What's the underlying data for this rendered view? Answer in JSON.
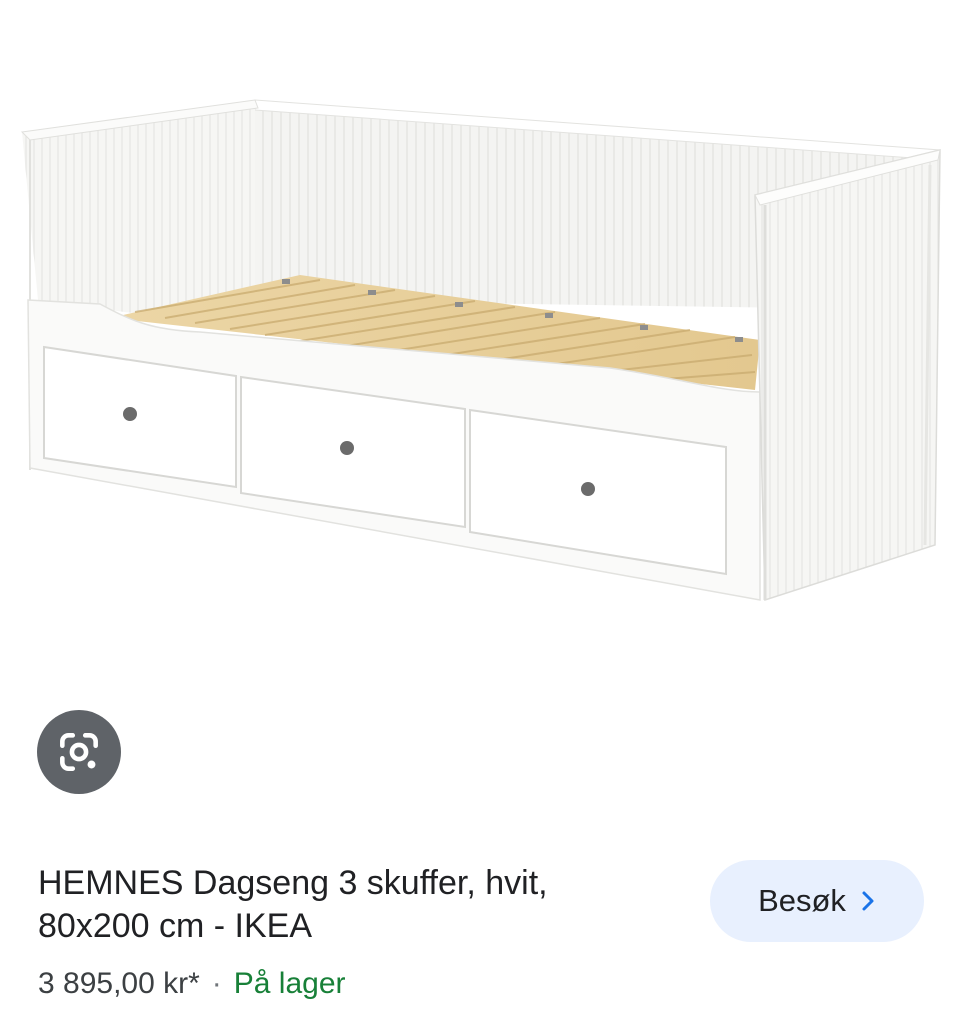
{
  "image": {
    "alt": "HEMNES Dagseng 3 skuffer, hvit, 80x200 cm - IKEA"
  },
  "lens": {
    "icon": "google-lens-icon"
  },
  "result": {
    "title": "HEMNES Dagseng 3 skuffer, hvit, 80x200 cm - IKEA",
    "price": "3 895,00 kr*",
    "separator": "·",
    "availability": "På lager"
  },
  "visit_button": {
    "label": "Besøk",
    "icon": "chevron-right-icon"
  },
  "colors": {
    "accent": "#1a73e8",
    "button_bg": "#e8f0fe",
    "in_stock": "#188038",
    "lens_bg": "#5f6368"
  }
}
